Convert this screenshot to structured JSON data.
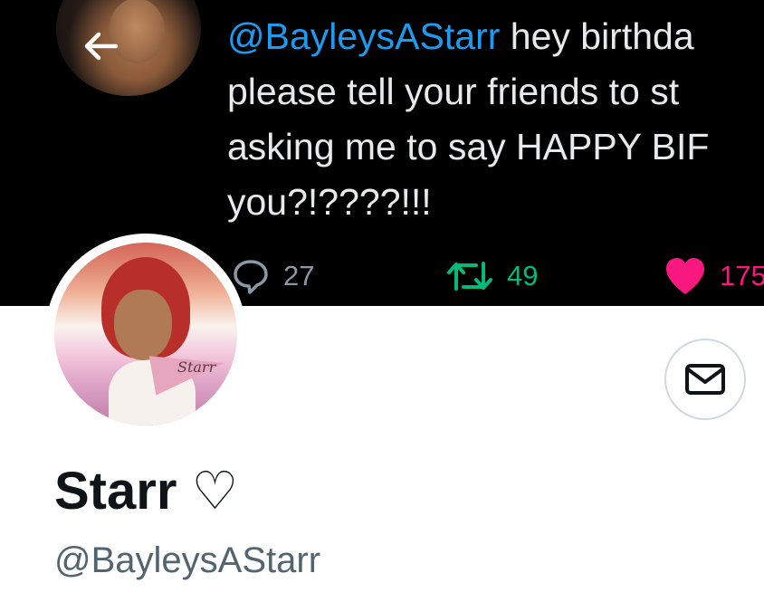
{
  "banner": {
    "tweet": {
      "mention": "@BayleysAStarr",
      "lines": [
        " hey birthda",
        "please tell your friends to st",
        "asking me to say HAPPY BIF",
        "you?!????!!!"
      ]
    },
    "actions": {
      "reply_count": "27",
      "retweet_count": "49",
      "like_count": "175"
    }
  },
  "nav": {
    "back_icon": "arrow-left-icon"
  },
  "profile": {
    "avatar_tag": "Starr",
    "display_name": "Starr",
    "name_suffix": "♡",
    "handle": "@BayleysAStarr",
    "message_icon": "envelope-icon"
  },
  "colors": {
    "mention": "#1d9bf0",
    "retweet": "#00ba7c",
    "like": "#f91880",
    "muted": "#536471",
    "border": "#cfd9de"
  }
}
